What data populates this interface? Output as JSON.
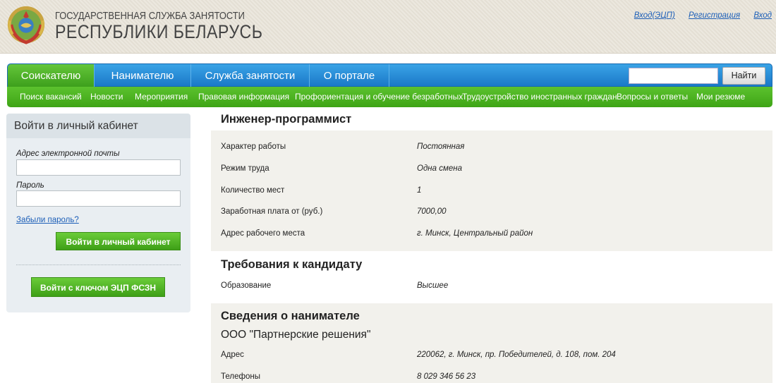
{
  "header": {
    "title_line1": "ГОСУДАРСТВЕННАЯ СЛУЖБА ЗАНЯТОСТИ",
    "title_line2": "РЕСПУБЛИКИ БЕЛАРУСЬ",
    "links": [
      "Вход(ЭЦП)",
      "Регистрация",
      "Вход"
    ]
  },
  "nav": {
    "tabs": [
      "Соискателю",
      "Нанимателю",
      "Служба занятости",
      "О портале"
    ],
    "search_button": "Найти",
    "sub_items": [
      "Поиск вакансий",
      "Новости",
      "Мероприятия",
      "Правовая информация",
      "Профориентация и обучение безработных",
      "Трудоустройство иностранных граждан",
      "Вопросы и ответы",
      "Мои резюме"
    ]
  },
  "login": {
    "title": "Войти в личный кабинет",
    "email_label": "Адрес электронной почты",
    "password_label": "Пароль",
    "forgot": "Забыли пароль?",
    "login_button": "Войти в личный кабинет",
    "ecp_button": "Войти с ключом ЭЦП ФСЗН"
  },
  "vacancy": {
    "title": "Инженер-программист",
    "details": [
      {
        "label": "Характер работы",
        "value": "Постоянная"
      },
      {
        "label": "Режим труда",
        "value": "Одна смена"
      },
      {
        "label": "Количество мест",
        "value": "1"
      },
      {
        "label": "Заработная плата от (руб.)",
        "value": "7000,00"
      },
      {
        "label": "Адрес рабочего места",
        "value": "г. Минск, Центральный район"
      }
    ],
    "requirements_title": "Требования к кандидату",
    "requirements": [
      {
        "label": "Образование",
        "value": "Высшее"
      }
    ],
    "employer_title": "Сведения о нанимателе",
    "employer_name": "ООО \"Партнерские решения\"",
    "employer": [
      {
        "label": "Адрес",
        "value": "220062, г. Минск, пр. Победителей, д. 108, пом. 204"
      },
      {
        "label": "Телефоны",
        "value": "8 029 346 56 23"
      }
    ]
  },
  "colors": {
    "nav_blue": "#1a79c8",
    "nav_green": "#3ea416",
    "link_blue": "#1d5fb8"
  }
}
